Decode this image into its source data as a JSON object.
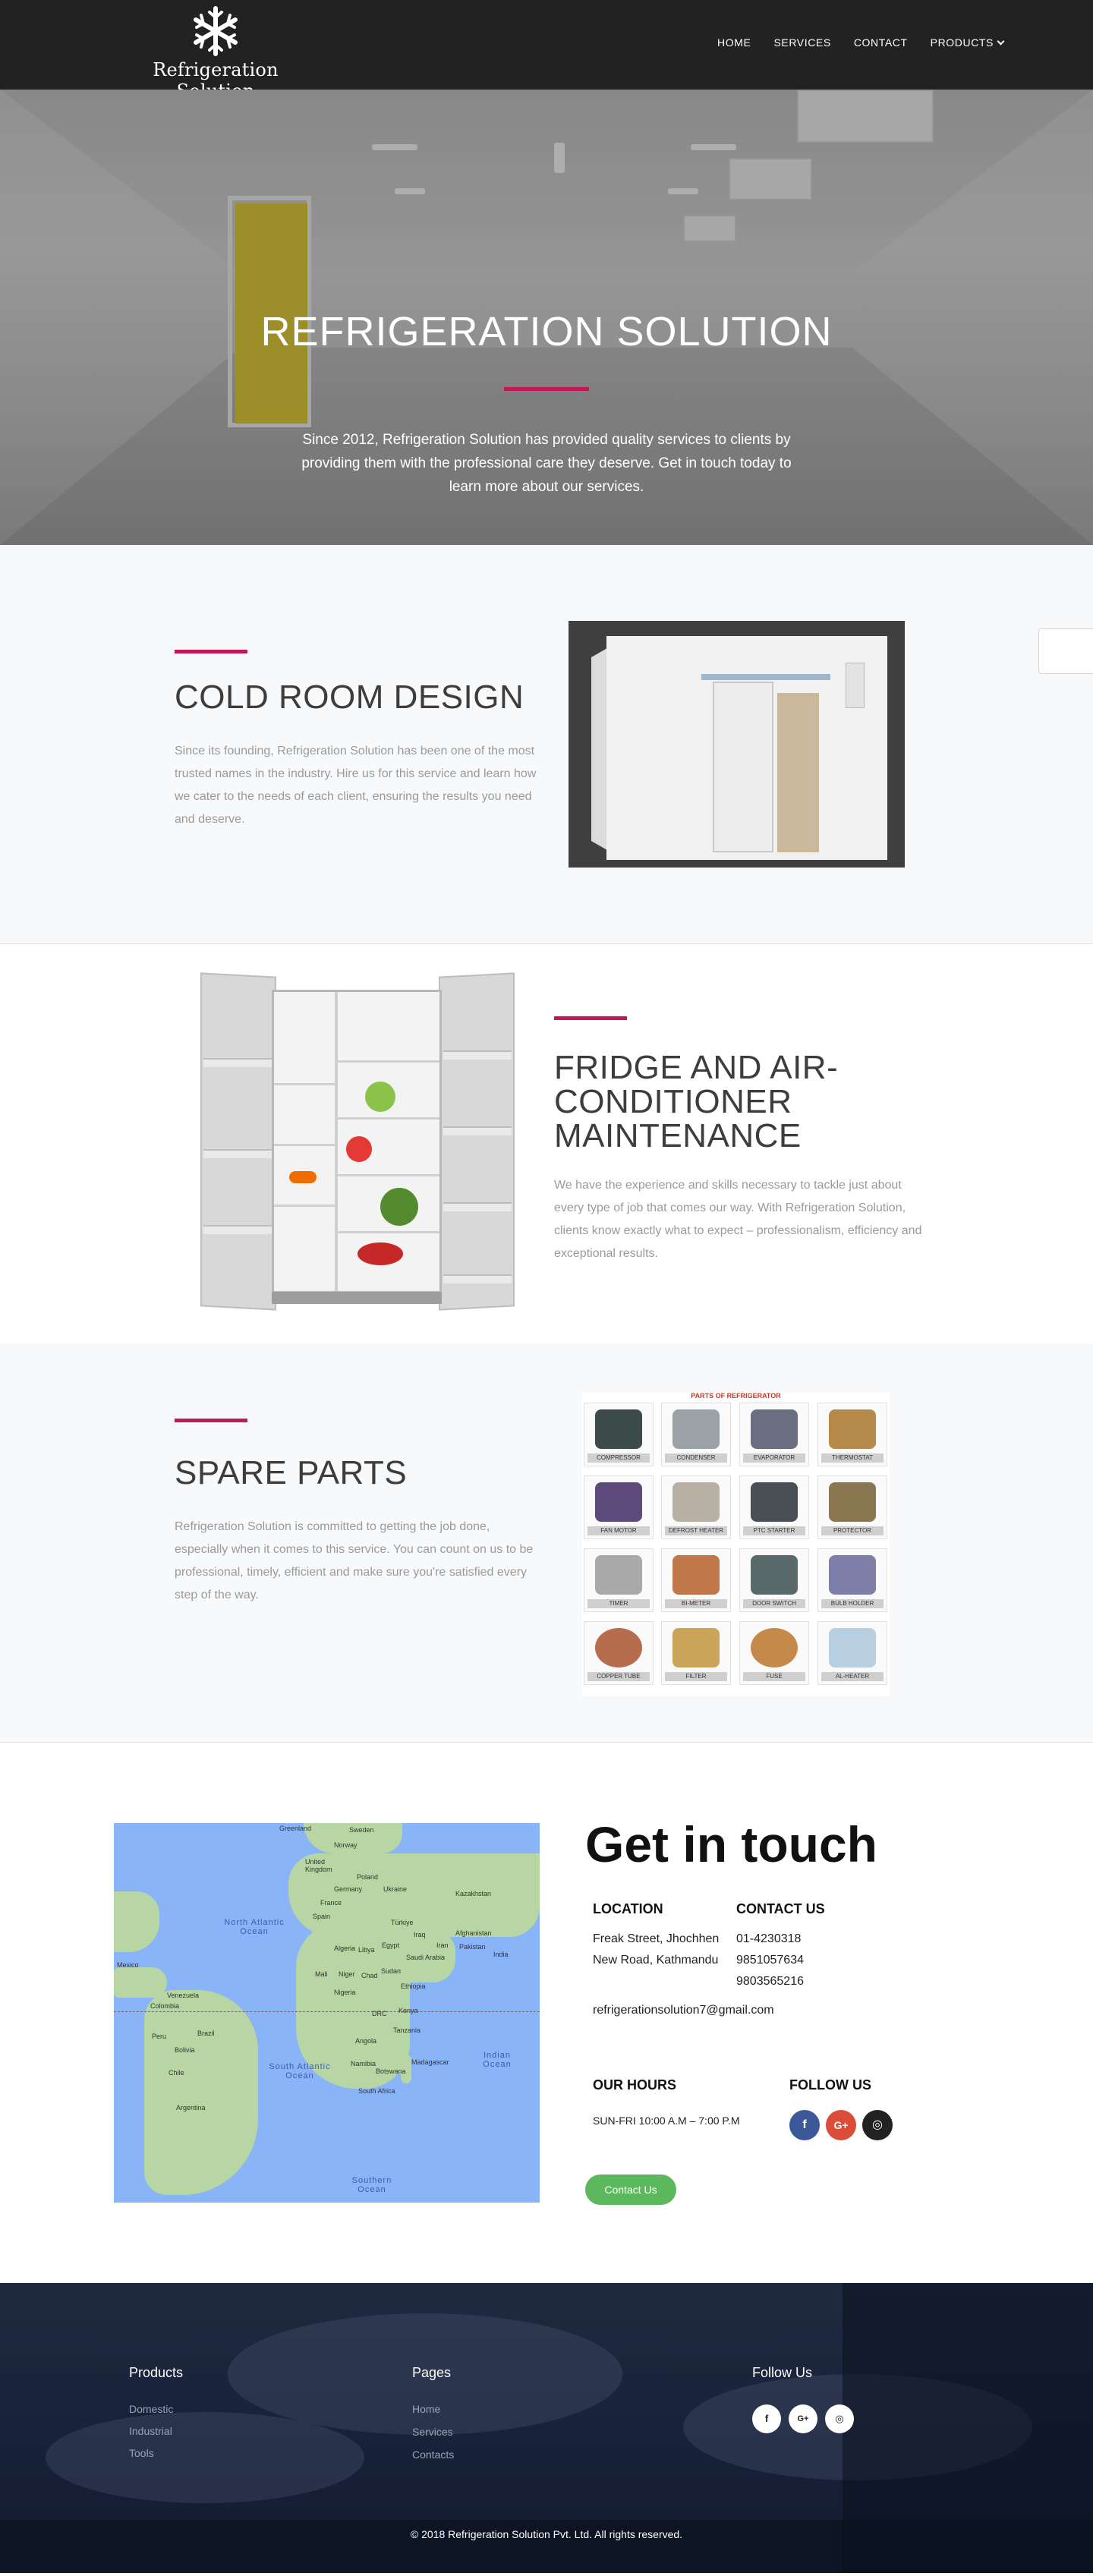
{
  "brand": {
    "name": "Refrigeration Solution",
    "logo_icon": "snowflake-icon"
  },
  "nav": {
    "items": [
      {
        "label": "HOME"
      },
      {
        "label": "SERVICES"
      },
      {
        "label": "CONTACT"
      },
      {
        "label": "PRODUCTS",
        "icon": "chevron-down-icon"
      }
    ]
  },
  "hero": {
    "title": "REFRIGERATION SOLUTION",
    "subtitle": "Since 2012, Refrigeration Solution has provided quality services to clients by providing them with the professional care they deserve. Get in touch today to learn more about our services."
  },
  "sections": [
    {
      "title": "COLD ROOM DESIGN",
      "text": "Since its founding, Refrigeration Solution has been one of the most trusted names in the industry. Hire us for this service and learn how we cater to the needs of each client, ensuring the results you need and deserve."
    },
    {
      "title": "FRIDGE AND AIR-CONDITIONER MAINTENANCE",
      "text": "We have the experience and skills necessary to tackle just about every type of job that comes our way. With Refrigeration Solution, clients know exactly what to expect – professionalism, efficiency and exceptional results."
    },
    {
      "title": "SPARE PARTS",
      "text": "Refrigeration Solution is committed to getting the job done, especially when it comes to this service. You can count on us to be professional, timely, efficient and make sure you're satisfied every step of the way."
    }
  ],
  "parts_image": {
    "title": "PARTS OF REFRIGERATOR",
    "labels": [
      "COMPRESSOR",
      "CONDENSER",
      "EVAPORATOR",
      "THERMOSTAT",
      "FAN MOTOR",
      "DEFROST HEATER",
      "PTC STARTER",
      "PROTECTOR",
      "TIMER",
      "BI-METER",
      "DOOR SWITCH",
      "BULB HOLDER",
      "COPPER TUBE",
      "FILTER",
      "FUSE",
      "AL-HEATER"
    ]
  },
  "map": {
    "ocean_labels": [
      "North Atlantic Ocean",
      "South Atlantic Ocean",
      "Indian Ocean",
      "Southern Ocean"
    ],
    "place_labels": [
      "Greenland",
      "Sweden",
      "Norway",
      "Poland",
      "United Kingdom",
      "Germany",
      "Ukraine",
      "France",
      "Spain",
      "Kazakhstan",
      "Türkiye",
      "Iraq",
      "Afghanistan",
      "Pakistan",
      "India",
      "Iran",
      "Saudi Arabia",
      "Algeria",
      "Libya",
      "Egypt",
      "Mali",
      "Niger",
      "Chad",
      "Sudan",
      "Ethiopia",
      "Nigeria",
      "DRC",
      "Kenya",
      "Tanzania",
      "Angola",
      "Namibia",
      "Botswana",
      "South Africa",
      "Madagascar",
      "Venezuela",
      "Colombia",
      "Peru",
      "Brazil",
      "Bolivia",
      "Chile",
      "Argentina",
      "Mexico"
    ]
  },
  "contact": {
    "heading": "Get in touch",
    "location_label": "LOCATION",
    "location_lines": [
      "Freak Street, Jhochhen",
      "New Road, Kathmandu"
    ],
    "contact_label": "CONTACT US",
    "phones": [
      "01-4230318",
      "9851057634",
      "9803565216"
    ],
    "email": "refrigerationsolution7@gmail.com",
    "hours_label": "OUR HOURS",
    "hours": "SUN-FRI 10:00 A.M – 7:00 P.M",
    "follow_label": "FOLLOW US",
    "social": [
      {
        "name": "facebook",
        "glyph": "f",
        "color": "#3b5998"
      },
      {
        "name": "google-plus",
        "glyph": "G+",
        "color": "#dd4b39"
      },
      {
        "name": "instagram",
        "glyph": "◎",
        "color": "#222222"
      }
    ],
    "button_label": "Contact Us"
  },
  "footer": {
    "products_heading": "Products",
    "products": [
      "Domestic",
      "Industrial",
      "Tools"
    ],
    "pages_heading": "Pages",
    "pages": [
      "Home",
      "Services",
      "Contacts"
    ],
    "follow_heading": "Follow Us",
    "social_glyphs": [
      "f",
      "G+",
      "◎"
    ],
    "copyright": "© 2018 Refrigeration Solution Pvt. Ltd. All rights reserved."
  }
}
